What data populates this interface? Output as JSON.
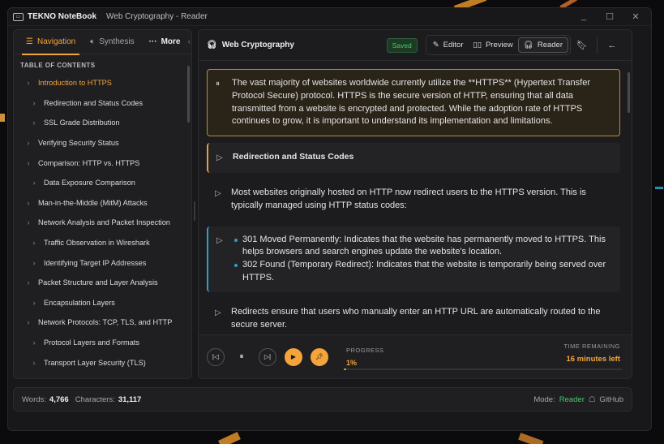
{
  "window": {
    "app_name": "TEKNO NoteBook",
    "doc_title": "Web Cryptography - Reader",
    "controls": [
      "_",
      "☐",
      "✕"
    ]
  },
  "sidebar": {
    "tabs": [
      {
        "label": "Navigation",
        "icon": "list-icon"
      },
      {
        "label": "Synthesis",
        "icon": "speaker-icon"
      },
      {
        "label": "More",
        "icon": "dots-icon"
      }
    ],
    "collapse_glyph": "‹",
    "toc_heading": "TABLE OF CONTENTS",
    "toc": [
      {
        "label": "Introduction to HTTPS",
        "level": 1,
        "current": true
      },
      {
        "label": "Redirection and Status Codes",
        "level": 2
      },
      {
        "label": "SSL Grade Distribution",
        "level": 2
      },
      {
        "label": "Verifying Security Status",
        "level": 1
      },
      {
        "label": "Comparison: HTTP vs. HTTPS",
        "level": 1
      },
      {
        "label": "Data Exposure Comparison",
        "level": 2
      },
      {
        "label": "Man-in-the-Middle (MitM) Attacks",
        "level": 1
      },
      {
        "label": "Network Analysis and Packet Inspection",
        "level": 1
      },
      {
        "label": "Traffic Observation in Wireshark",
        "level": 2
      },
      {
        "label": "Identifying Target IP Addresses",
        "level": 2
      },
      {
        "label": "Packet Structure and Layer Analysis",
        "level": 1
      },
      {
        "label": "Encapsulation Layers",
        "level": 2
      },
      {
        "label": "Network Protocols: TCP, TLS, and HTTP",
        "level": 1
      },
      {
        "label": "Protocol Layers and Formats",
        "level": 2
      },
      {
        "label": "Transport Layer Security (TLS)",
        "level": 2
      }
    ]
  },
  "reader": {
    "title": "Web Cryptography",
    "saved_label": "Saved",
    "modes": [
      {
        "label": "Editor",
        "icon": "pencil-icon"
      },
      {
        "label": "Preview",
        "icon": "book-icon"
      },
      {
        "label": "Reader",
        "icon": "headphones-icon",
        "active": true
      }
    ],
    "paragraphs": [
      {
        "type": "active",
        "icon": "⏸",
        "text": "The vast majority of websites worldwide currently utilize the **HTTPS** (Hypertext Transfer Protocol Secure) protocol. HTTPS is the secure version of HTTP, ensuring that all data transmitted from a website is encrypted and protected. While the adoption rate of HTTPS continues to grow, it is important to understand its implementation and limitations."
      },
      {
        "type": "heading",
        "icon": "▷",
        "text": "Redirection and Status Codes"
      },
      {
        "type": "normal",
        "icon": "▷",
        "text": "Most websites originally hosted on HTTP now redirect users to the HTTPS version. This is typically managed using HTTP status codes:"
      },
      {
        "type": "list",
        "icon": "▷",
        "items": [
          "301 Moved Permanently: Indicates that the website has permanently moved to HTTPS. This helps browsers and search engines update the website's location.",
          "302 Found (Temporary Redirect): Indicates that the website is temporarily being served over HTTPS."
        ]
      },
      {
        "type": "normal",
        "icon": "▷",
        "text": "Redirects ensure that users who manually enter an HTTP URL are automatically routed to the secure server."
      }
    ],
    "player": {
      "progress_label": "PROGRESS",
      "progress_value": "1%",
      "progress_fraction": 0.01,
      "time_label": "TIME REMAINING",
      "time_value": "16 minutes left"
    }
  },
  "status": {
    "words_label": "Words:",
    "words_value": "4,766",
    "chars_label": "Characters:",
    "chars_value": "31,117",
    "mode_label": "Mode:",
    "mode_value": "Reader",
    "github_label": "GitHub"
  },
  "colors": {
    "accent": "#f4a53a",
    "saved_green": "#4ec46e",
    "list_accent": "#2aa0c8"
  }
}
